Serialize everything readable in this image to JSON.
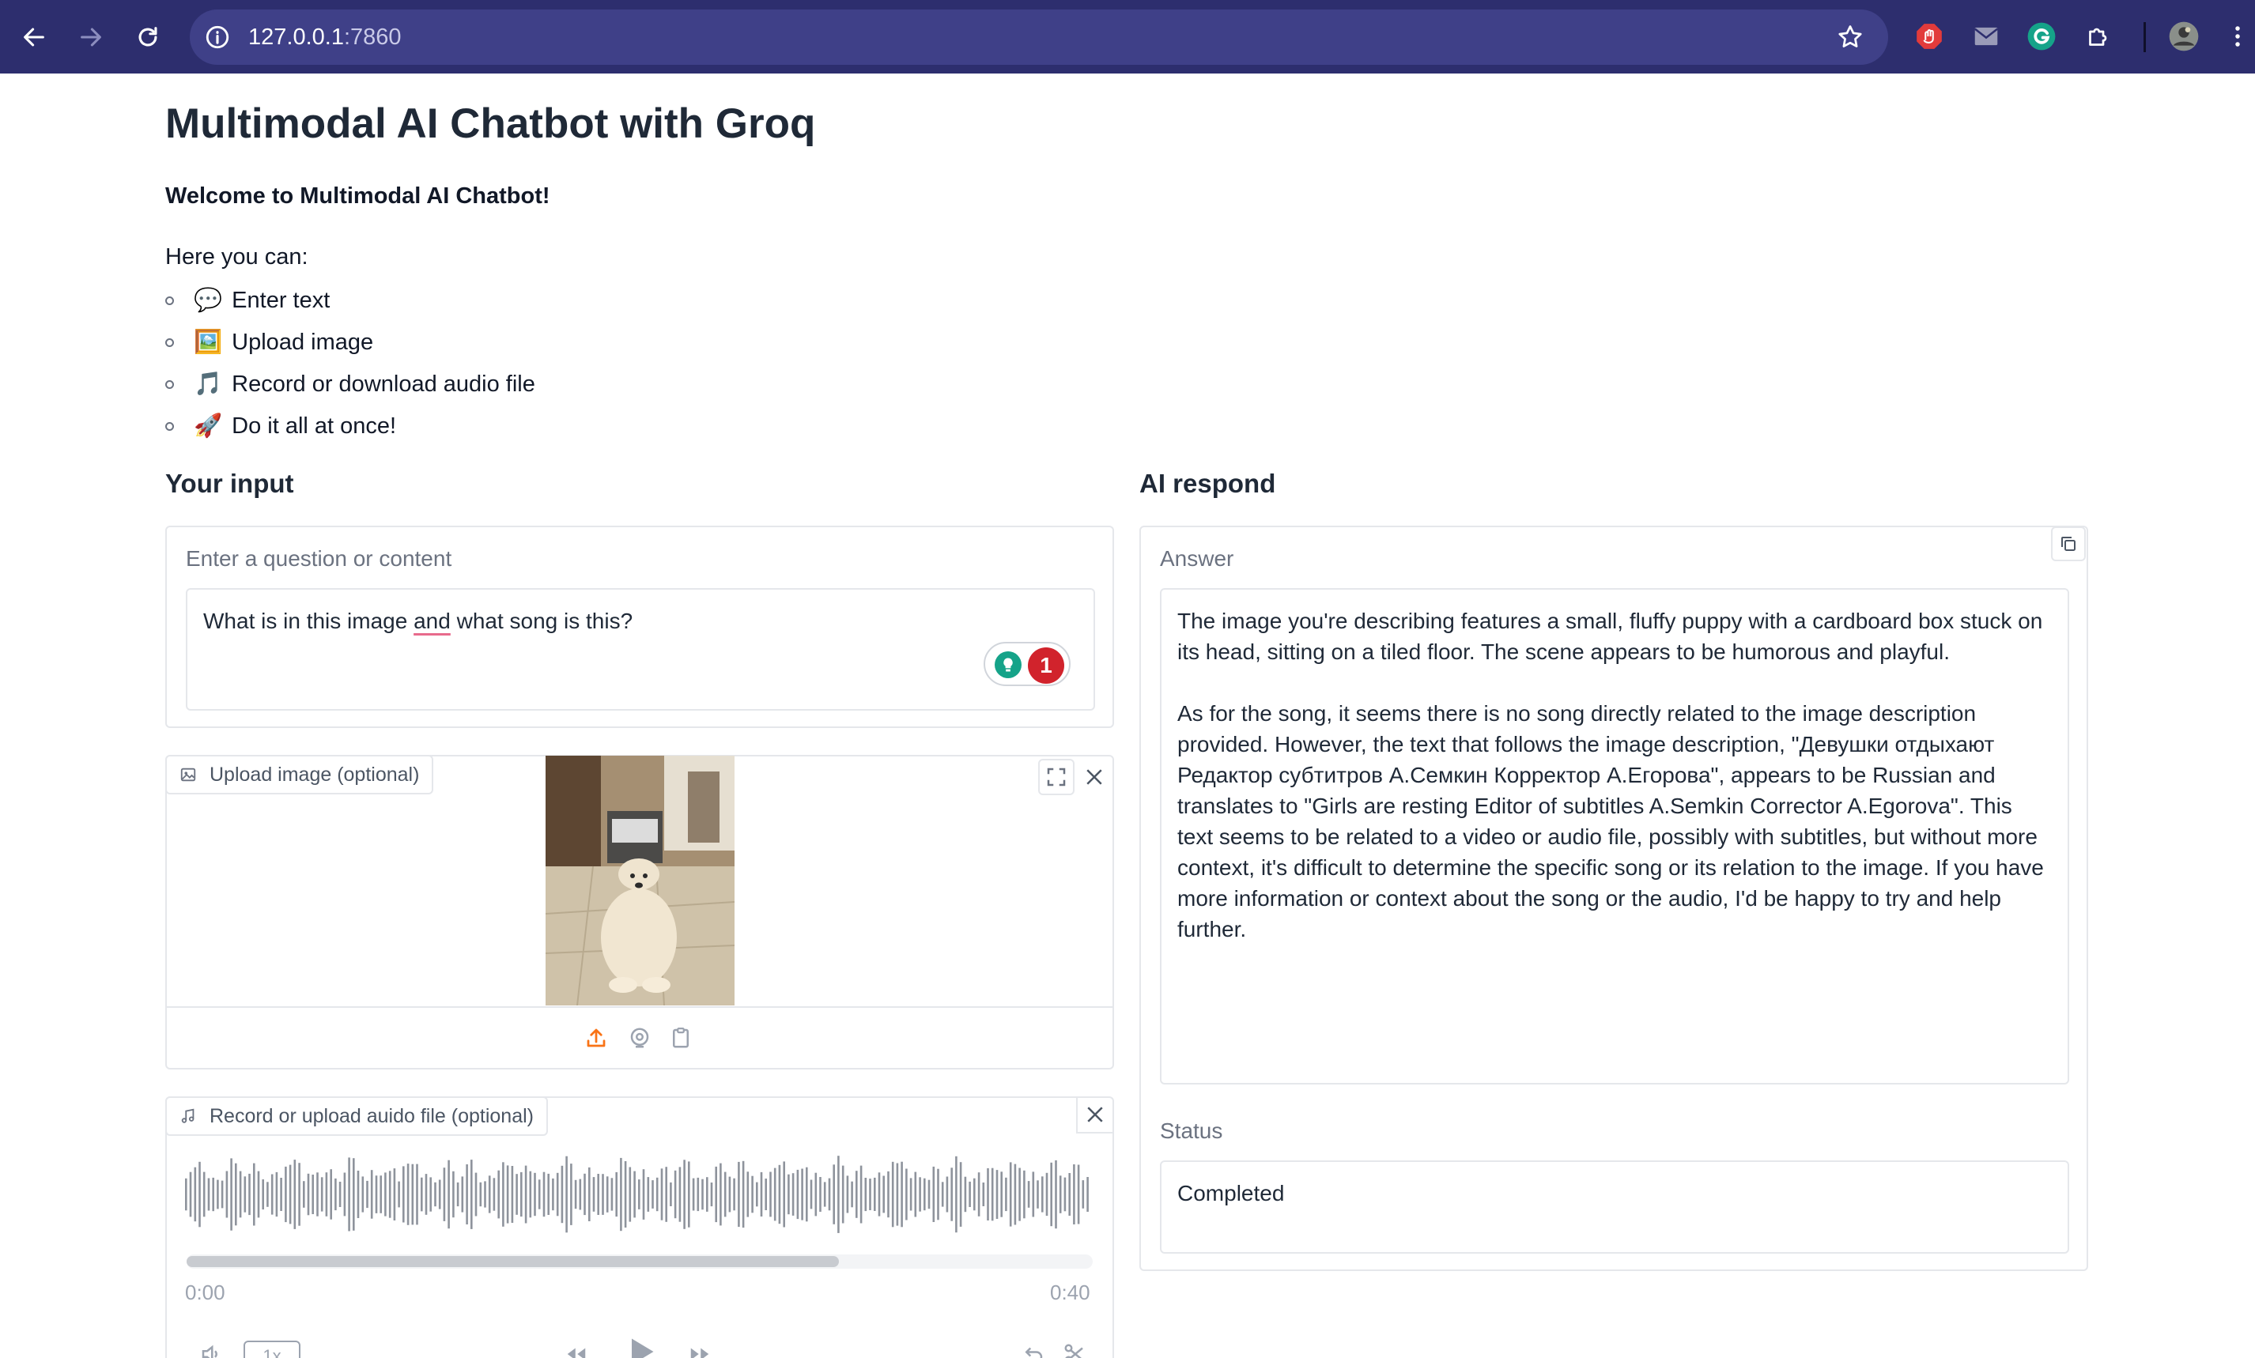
{
  "browser": {
    "url_host": "127.0.0.1",
    "url_port": ":7860"
  },
  "page": {
    "title": "Multimodal AI Chatbot with Groq",
    "welcome": "Welcome to Multimodal AI Chatbot!",
    "intro": "Here you can:",
    "features": [
      {
        "emoji": "💬",
        "text": "Enter text"
      },
      {
        "emoji": "🖼️",
        "text": "Upload image"
      },
      {
        "emoji": "🎵",
        "text": "Record or download audio file"
      },
      {
        "emoji": "🚀",
        "text": "Do it all at once!"
      }
    ]
  },
  "input": {
    "heading": "Your input",
    "question_label": "Enter a question or content",
    "question_value_before": "What is in this image ",
    "question_value_underlined": "and",
    "question_value_after": " what song is this?",
    "grammarly_count": "1",
    "image_label": "Upload image (optional)",
    "audio_label": "Record or upload auido file (optional)",
    "audio_time_current": "0:00",
    "audio_time_total": "0:40",
    "audio_progress": 0.72,
    "playback_rate": "1x"
  },
  "output": {
    "heading": "AI respond",
    "answer_label": "Answer",
    "answer_text": "The image you're describing features a small, fluffy puppy with a cardboard box stuck on its head, sitting on a tiled floor. The scene appears to be humorous and playful.\n\nAs for the song, it seems there is no song directly related to the image description provided. However, the text that follows the image description, \"Девушки отдыхают Редактор субтитров А.Семкин Корректор А.Егорова\", appears to be Russian and translates to \"Girls are resting Editor of subtitles A.Semkin Corrector A.Egorova\". This text seems to be related to a video or audio file, possibly with subtitles, but without more context, it's difficult to determine the specific song or its relation to the image. If you have more information or context about the song or the audio, I'd be happy to try and help further.",
    "status_label": "Status",
    "status_value": "Completed"
  },
  "colors": {
    "chrome_bg": "#2d2e6e",
    "omnibox_bg": "#3f4088",
    "accent_orange": "#f97316",
    "grammarly_red": "#d1232c",
    "grammarly_green": "#15a389"
  },
  "icons": {
    "nav": [
      "back-arrow-icon",
      "forward-arrow-icon",
      "reload-icon"
    ],
    "extensions": [
      "adblock-icon",
      "mail-icon",
      "grammarly-icon",
      "puzzle-icon"
    ],
    "image_sources": [
      "upload-icon",
      "webcam-icon",
      "clipboard-icon"
    ]
  }
}
